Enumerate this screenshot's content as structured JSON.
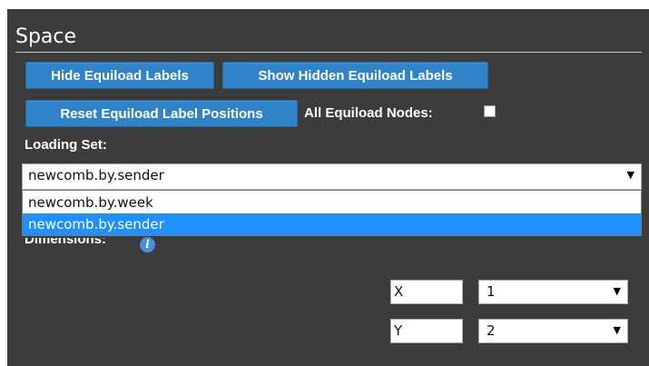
{
  "section": {
    "title": "Space"
  },
  "buttons": {
    "hide_labels": "Hide Equiload Labels",
    "show_hidden": "Show Hidden Equiload Labels",
    "reset_positions": "Reset Equiload Label Positions"
  },
  "all_nodes": {
    "label": "All Equiload Nodes:",
    "checked": false
  },
  "loading_set": {
    "label": "Loading Set:",
    "selected": "newcomb.by.sender",
    "options": [
      "newcomb.by.week",
      "newcomb.by.sender"
    ],
    "highlighted_index": 1
  },
  "dimensions": {
    "label": "Dimensions:",
    "rows": [
      {
        "axis": "X",
        "value": "1"
      },
      {
        "axis": "Y",
        "value": "2"
      }
    ]
  },
  "icons": {
    "info": "info-icon",
    "dropdown": "chevron-down-icon"
  },
  "colors": {
    "panel_bg": "#3c3c3c",
    "button_bg": "#2f83c6",
    "highlight": "#1e90ff"
  }
}
